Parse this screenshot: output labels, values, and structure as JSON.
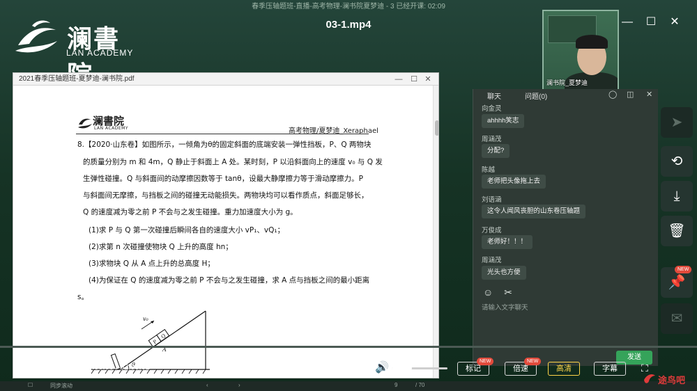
{
  "window": {
    "title": "春季压轴题班-直播-高考物理-澜书院夏梦迪 - 3  已经开课: 02:09",
    "video_file": "03-1.mp4"
  },
  "logo": {
    "cn": "澜書院",
    "en": "LAN ACADEMY"
  },
  "webcam": {
    "caption": "澜书院_夏梦迪"
  },
  "pdf": {
    "filename": "2021春季压轴题班-夏梦迪-澜书院.pdf",
    "page_logo_cn": "澜書院",
    "page_logo_en": "LAN ACADEMY",
    "header_right": "高考物理/夏梦迪_Xeraphael",
    "question_lines": [
      "8.【2020·山东卷】如图所示，一倾角为θ的固定斜面的底端安装一弹性挡板，P、Q 两物块",
      "的质量分别为 m 和 4m，Q 静止于斜面上 A 处。某时刻，P 以沿斜面向上的速度 v₀ 与 Q 发",
      "生弹性碰撞。Q 与斜面间的动摩擦因数等于 tanθ，设最大静摩擦力等于滑动摩擦力。P",
      "与斜面间无摩擦，与挡板之间的碰撞无动能损失。两物块均可以看作质点，斜面足够长，",
      "Q 的速度减为零之前 P 不会与之发生碰撞。重力加速度大小为 g。"
    ],
    "sub_questions": [
      "(1)求 P 与 Q 第一次碰撞后瞬间各自的速度大小 vP₁、vQ₁；",
      "(2)求第 n 次碰撞使物块 Q 上升的高度 hn；",
      "(3)求物块 Q 从 A 点上升的总高度 H；",
      "(4)为保证在 Q 的速度减为零之前 P 不会与之发生碰撞，求 A 点与挡板之间的最小距离"
    ],
    "tail": "s。",
    "figure_labels": {
      "v0": "v₀",
      "p": "P",
      "q": "Q",
      "a": "A",
      "theta": "θ"
    }
  },
  "chat": {
    "tabs": [
      "聊天",
      "问题(0)"
    ],
    "messages": [
      {
        "name": "向金灵",
        "text": "ahhhh笑志"
      },
      {
        "name": "周涵茂",
        "text": "分配?"
      },
      {
        "name": "陈越",
        "text": "老师把头像拖上去"
      },
      {
        "name": "刘语涵",
        "text": "这令人闻风丧胆的山东卷压轴题"
      },
      {
        "name": "万俊成",
        "text": "老师好！！！"
      },
      {
        "name": "周涵茂",
        "text": "光头也方便"
      }
    ],
    "input_placeholder": "请输入文字聊天",
    "send_label": "发送"
  },
  "player": {
    "time": "00:00:00 / 02:00:01",
    "progress": 0.0,
    "volume": 0.3,
    "buttons": {
      "mark": "标记",
      "speed": "倍速",
      "hd": "高清",
      "subtitle": "字幕"
    },
    "new_badge": "NEW"
  },
  "bottom_bar": {
    "sync": "同步滚动",
    "page_current": "9",
    "page_total": "/ 70"
  },
  "watermark": "途鸟吧",
  "colors": {
    "accent_green": "#35a35a",
    "new_badge": "#e24a3b",
    "hd_active": "#ffd54a"
  }
}
